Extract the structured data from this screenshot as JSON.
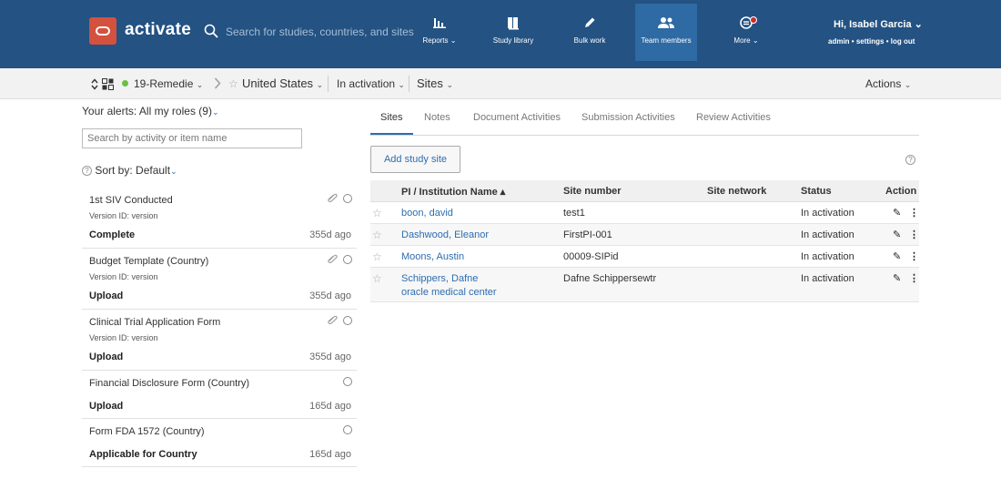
{
  "header": {
    "app_name": "activate",
    "search_placeholder": "Search for studies, countries, and sites",
    "nav": [
      {
        "label": "Reports",
        "icon": "bar-chart-icon",
        "chevron": "⌄"
      },
      {
        "label": "Study library",
        "icon": "book-icon"
      },
      {
        "label": "Bulk work",
        "icon": "pencil-icon"
      },
      {
        "label": "Team members",
        "icon": "users-icon",
        "active": true
      },
      {
        "label": "More",
        "icon": "notification-icon",
        "chevron": "⌄"
      }
    ],
    "greeting": "Hi, Isabel Garcia",
    "greeting_chevron": "⌄",
    "links": [
      "admin",
      "settings",
      "log out"
    ]
  },
  "breadcrumb": {
    "study": "19-Remedie",
    "country": "United States",
    "status": "In activation",
    "view": "Sites",
    "actions": "Actions"
  },
  "alerts": {
    "title": "Your alerts: All my roles (9)",
    "search_placeholder": "Search by activity or item name",
    "sort_label": "Sort by: Default",
    "help_glyph": "?",
    "items": [
      {
        "title": "1st SIV Conducted",
        "version": "Version ID: version",
        "action": "Complete",
        "age": "355d ago",
        "has_attachment": true
      },
      {
        "title": "Budget Template (Country)",
        "version": "Version ID: version",
        "action": "Upload",
        "age": "355d ago",
        "has_attachment": true
      },
      {
        "title": "Clinical Trial Application Form",
        "version": "Version ID: version",
        "action": "Upload",
        "age": "355d ago",
        "has_attachment": true
      },
      {
        "title": "Financial Disclosure Form (Country)",
        "version": "",
        "action": "Upload",
        "age": "165d ago",
        "has_attachment": false
      },
      {
        "title": "Form FDA 1572 (Country)",
        "version": "",
        "action": "Applicable for Country",
        "age": "165d ago",
        "has_attachment": false
      }
    ]
  },
  "tabs": [
    "Sites",
    "Notes",
    "Document Activities",
    "Submission Activities",
    "Review Activities"
  ],
  "add_button": "Add study site",
  "table": {
    "columns": [
      "PI / Institution Name ▴",
      "Site number",
      "Site network",
      "Status",
      "Action"
    ],
    "rows": [
      {
        "name": "boon, david",
        "institution": "",
        "site_number": "test1",
        "network": "",
        "status": "In activation"
      },
      {
        "name": "Dashwood, Eleanor",
        "institution": "",
        "site_number": "FirstPI-001",
        "network": "",
        "status": "In activation"
      },
      {
        "name": "Moons, Austin",
        "institution": "",
        "site_number": "00009-SIPid",
        "network": "",
        "status": "In activation"
      },
      {
        "name": "Schippers, Dafne",
        "institution": "oracle medical center",
        "site_number": "Dafne Schippersewtr",
        "network": "",
        "status": "In activation"
      }
    ]
  },
  "colors": {
    "header_bg": "#235283",
    "active_nav": "#2e6aa3",
    "link": "#2d6db0",
    "logo": "#d3513d",
    "status_dot": "#6abf40"
  }
}
